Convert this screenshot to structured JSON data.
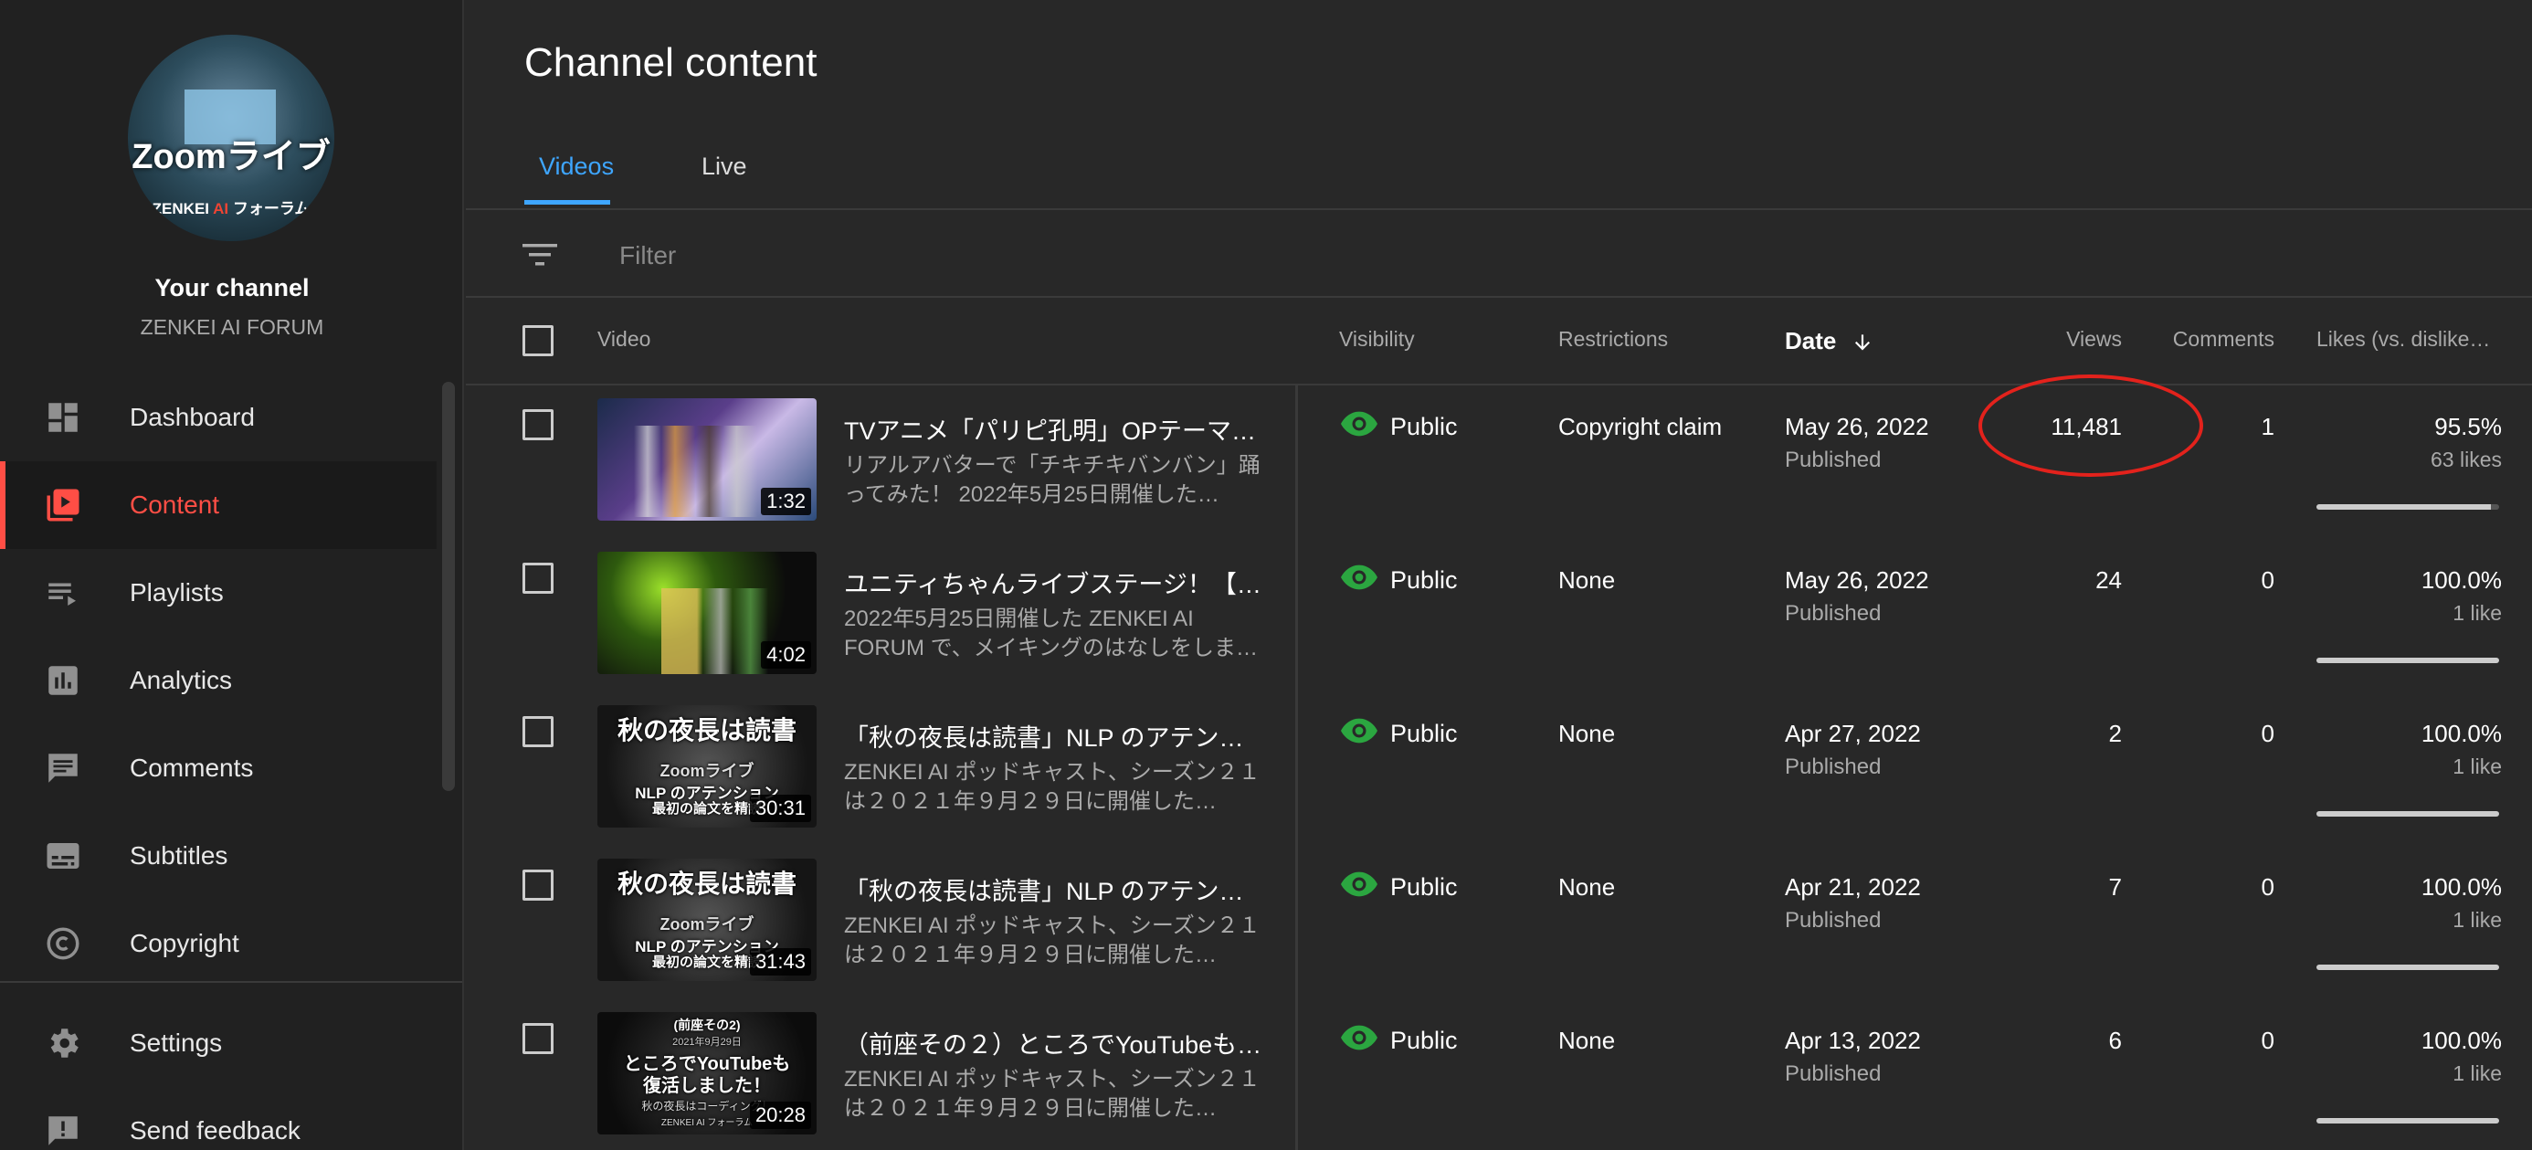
{
  "sidebar": {
    "avatar": {
      "top_text": "Zoomライブ",
      "bottom_text_prefix": "ZENKEI ",
      "bottom_text_ai": "AI",
      "bottom_text_suffix": " フォーラム"
    },
    "your_channel": "Your channel",
    "channel_name": "ZENKEI AI FORUM",
    "items": [
      {
        "label": "Dashboard",
        "icon": "dashboard-icon"
      },
      {
        "label": "Content",
        "icon": "content-icon",
        "active": true
      },
      {
        "label": "Playlists",
        "icon": "playlists-icon"
      },
      {
        "label": "Analytics",
        "icon": "analytics-icon"
      },
      {
        "label": "Comments",
        "icon": "comments-icon"
      },
      {
        "label": "Subtitles",
        "icon": "subtitles-icon"
      },
      {
        "label": "Copyright",
        "icon": "copyright-icon"
      }
    ],
    "bottom_items": [
      {
        "label": "Settings",
        "icon": "gear-icon"
      },
      {
        "label": "Send feedback",
        "icon": "feedback-icon"
      }
    ]
  },
  "main": {
    "title": "Channel content",
    "tabs": [
      {
        "label": "Videos",
        "active": true
      },
      {
        "label": "Live"
      }
    ],
    "filter": {
      "placeholder": "Filter"
    },
    "columns": {
      "video": "Video",
      "visibility": "Visibility",
      "restrictions": "Restrictions",
      "date": "Date",
      "views": "Views",
      "comments": "Comments",
      "likes": "Likes (vs. dislike…"
    },
    "rows": [
      {
        "title": "TVアニメ「パリピ孔明」OPテーマ「…",
        "desc": "リアルアバターで「チキチキバンバン」踊ってみた！ 2022年5月25日開催した…",
        "duration": "1:32",
        "visibility": "Public",
        "restrictions": "Copyright claim",
        "date": "May 26, 2022",
        "status": "Published",
        "views": "11,481",
        "comments": "1",
        "likes_pct": "95.5%",
        "likes_cnt": "63 likes",
        "likes_ratio": 0.955
      },
      {
        "title": "ユニティちゃんライブステージ！【踊…",
        "desc": "2022年5月25日開催した ZENKEI AI FORUM で、メイキングのはなしをしま…",
        "duration": "4:02",
        "visibility": "Public",
        "restrictions": "None",
        "date": "May 26, 2022",
        "status": "Published",
        "views": "24",
        "comments": "0",
        "likes_pct": "100.0%",
        "likes_cnt": "1 like",
        "likes_ratio": 1.0
      },
      {
        "title": "「秋の夜長は読書」NLP のアテンシ…",
        "desc": "ZENKEI AI ポッドキャスト、シーズン２１は２０２１年９月２９日に開催した…",
        "duration": "30:31",
        "visibility": "Public",
        "restrictions": "None",
        "date": "Apr 27, 2022",
        "status": "Published",
        "views": "2",
        "comments": "0",
        "likes_pct": "100.0%",
        "likes_cnt": "1 like",
        "likes_ratio": 1.0
      },
      {
        "title": "「秋の夜長は読書」NLP のアテンシ…",
        "desc": "ZENKEI AI ポッドキャスト、シーズン２１は２０２１年９月２９日に開催した…",
        "duration": "31:43",
        "visibility": "Public",
        "restrictions": "None",
        "date": "Apr 21, 2022",
        "status": "Published",
        "views": "7",
        "comments": "0",
        "likes_pct": "100.0%",
        "likes_cnt": "1 like",
        "likes_ratio": 1.0
      },
      {
        "title": "（前座その２）ところでYouTubeも復…",
        "desc": "ZENKEI AI ポッドキャスト、シーズン２１は２０２１年９月２９日に開催した…",
        "duration": "20:28",
        "visibility": "Public",
        "restrictions": "None",
        "date": "Apr 13, 2022",
        "status": "Published",
        "views": "6",
        "comments": "0",
        "likes_pct": "100.0%",
        "likes_cnt": "1 like",
        "likes_ratio": 1.0
      }
    ],
    "thumbnails": [
      {
        "texts": []
      },
      {
        "texts": []
      },
      {
        "texts": [
          "秋の夜長は読書",
          "Zoomライブ",
          "NLP のアテンション",
          "最初の論文を精読"
        ]
      },
      {
        "texts": [
          "秋の夜長は読書",
          "Zoomライブ",
          "NLP のアテンション",
          "最初の論文を精読"
        ]
      },
      {
        "texts": [
          "(前座その2)",
          "2021年9月29日",
          "ところでYouTubeも",
          "復活しました！",
          "秋の夜長はコーディング！",
          "ZENKEI AI フォーラム"
        ]
      }
    ]
  },
  "colors": {
    "accent": "#3ea6ff",
    "active_nav": "#ff4e45",
    "public_eye": "#2ba640",
    "highlight": "#e3221c"
  }
}
